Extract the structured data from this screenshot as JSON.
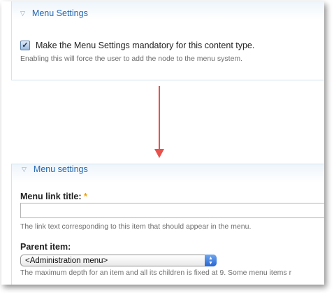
{
  "top_panel": {
    "legend": "Menu Settings",
    "checkbox_label": "Make the Menu Settings mandatory for this content type.",
    "checkbox_checked": true,
    "help": "Enabling this will force the user to add the node to the menu system."
  },
  "bottom_panel": {
    "legend": "Menu settings",
    "link_title_label": "Menu link title:",
    "required_marker": "*",
    "link_title_value": "",
    "link_title_help": "The link text corresponding to this item that should appear in the menu.",
    "parent_label": "Parent item:",
    "parent_selected": "<Administration menu>",
    "parent_help": "The maximum depth for an item and all its children is fixed at 9. Some menu items r"
  },
  "icons": {
    "collapse": "triangle-down-icon",
    "arrow": "arrow-down-icon",
    "select_caret": "updown-caret-icon"
  },
  "colors": {
    "legend": "#2266b3",
    "arrow": "#e8524c",
    "required": "#f0a000",
    "select_button": "#2866d1"
  }
}
